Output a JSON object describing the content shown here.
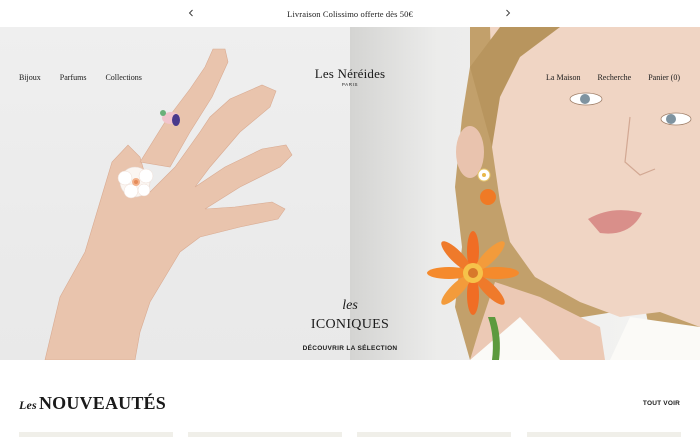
{
  "announcement": {
    "text": "Livraison Colissimo offerte dès 50€",
    "prev_icon": "chevron-left-icon",
    "next_icon": "chevron-right-icon"
  },
  "header": {
    "nav_left": [
      "Bijoux",
      "Parfums",
      "Collections"
    ],
    "logo": "Les Néréides",
    "logo_sub": "PARIS",
    "nav_right": [
      "La Maison",
      "Recherche",
      "Panier (0)"
    ]
  },
  "hero": {
    "les": "les",
    "title": "ICONIQUES",
    "cta": "DÉCOUVRIR LA SÉLECTION"
  },
  "new_arrivals": {
    "les": "Les",
    "title": "NOUVEAUTÉS",
    "see_all": "TOUT VOIR"
  },
  "colors": {
    "text": "#1a1a1a",
    "card_bg": "#f0efe9",
    "hero_left_bg": "#ececec",
    "flower": "#f0782a"
  }
}
